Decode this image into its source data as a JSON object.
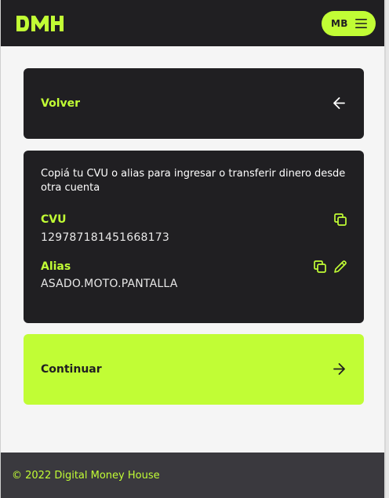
{
  "brand": {
    "logo_text": "DMH",
    "accent_color": "#c1fd35",
    "dark_color": "#201f22"
  },
  "header": {
    "user_initials": "MB",
    "menu_icon": "hamburger-menu-icon"
  },
  "back": {
    "label": "Volver",
    "icon": "arrow-left-icon"
  },
  "account_info": {
    "description": "Copiá tu CVU o alias para ingresar o transferir dinero desde otra cuenta",
    "cvu": {
      "label": "CVU",
      "value": "129787181451668173",
      "copy_icon": "copy-icon"
    },
    "alias": {
      "label": "Alias",
      "value": "ASADO.MOTO.PANTALLA",
      "copy_icon": "copy-icon",
      "edit_icon": "pencil-icon"
    }
  },
  "continue": {
    "label": "Continuar",
    "icon": "arrow-right-icon"
  },
  "footer": {
    "copyright": "© 2022 Digital Money House"
  }
}
